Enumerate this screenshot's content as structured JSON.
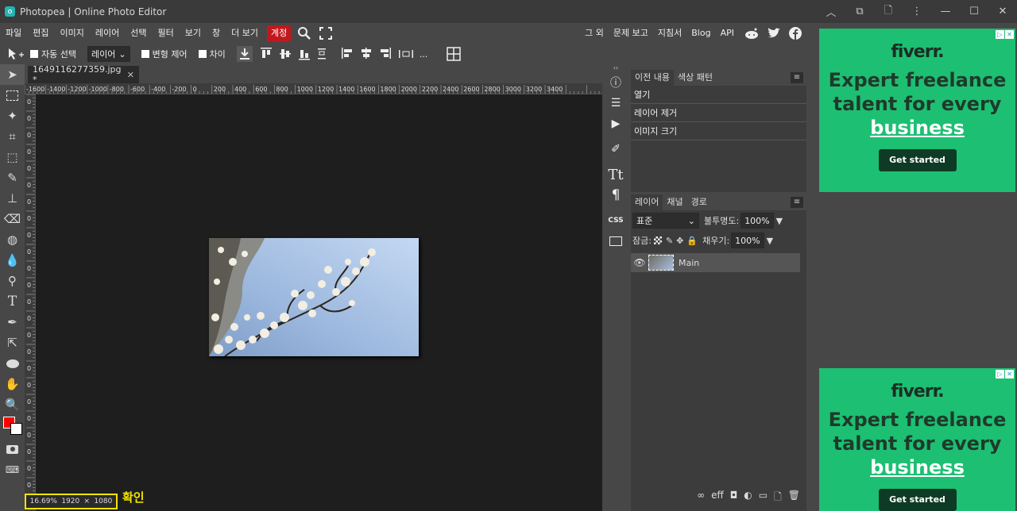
{
  "window": {
    "title": "Photopea | Online Photo Editor",
    "controls": [
      "︿",
      "⧉",
      "🗋",
      "⋮",
      "—",
      "☐",
      "✕"
    ]
  },
  "menu": {
    "items": [
      "파일",
      "편집",
      "이미지",
      "레이어",
      "선택",
      "필터",
      "보기",
      "창",
      "더 보기"
    ],
    "account": "계정",
    "right": [
      "그 외",
      "문제 보고",
      "지침서",
      "Blog",
      "API"
    ]
  },
  "options": {
    "auto_select": "자동 선택",
    "layer_select": "레이어",
    "transform": "변형 제어",
    "diff": "차이",
    "more": "..."
  },
  "document": {
    "tab": "1649116277359.jpg *",
    "close": "✕"
  },
  "ruler": {
    "h_labels": [
      "-1600",
      "-1400",
      "-1200",
      "-1000",
      "-800",
      "-600",
      "-400",
      "-200",
      "0",
      "200",
      "400",
      "600",
      "800",
      "1000",
      "1200",
      "1400",
      "1600",
      "1800",
      "2000",
      "2200",
      "2400",
      "2600",
      "2800",
      "3000",
      "3200",
      "3400"
    ],
    "v_labels": [
      "0",
      "0",
      "0",
      "0",
      "0",
      "0",
      "0",
      "0",
      "0",
      "0",
      "0",
      "0",
      "0",
      "0",
      "0",
      "0",
      "0",
      "0",
      "0",
      "0",
      "0",
      "0",
      "0",
      "0",
      "0"
    ]
  },
  "status": {
    "zoom": "16.69%",
    "width": "1920",
    "times": "×",
    "height": "1080"
  },
  "annotation": "확인",
  "history": {
    "tabs": [
      "이전 내용",
      "색상 패턴"
    ],
    "items": [
      "열기",
      "레이어 제거",
      "이미지 크기"
    ]
  },
  "layers": {
    "tabs": [
      "레이어",
      "채널",
      "경로"
    ],
    "blend": "표준",
    "opacity_label": "불투명도:",
    "opacity": "100%",
    "lock_label": "잠금:",
    "fill_label": "채우기:",
    "fill": "100%",
    "layer_name": "Main",
    "footer_icons": [
      "∞",
      "eff",
      "◘",
      "◐",
      "▭",
      "🗋",
      "🗑"
    ]
  },
  "iconcol": {
    "css": "CSS"
  },
  "ads": [
    {
      "logo": "fiverr.",
      "l1": "Expert freelance",
      "l2": "talent for every",
      "l3": "business",
      "cta": "Get started"
    },
    {
      "logo": "fiverr.",
      "l1": "Expert freelance",
      "l2": "talent for every",
      "l3": "business",
      "cta": "Get started"
    }
  ],
  "colors": {
    "foreground": "#ff0000",
    "background": "#ffffff",
    "accent": "#c2181d",
    "highlight": "#f2e500",
    "ad_bg": "#1dbf73"
  }
}
